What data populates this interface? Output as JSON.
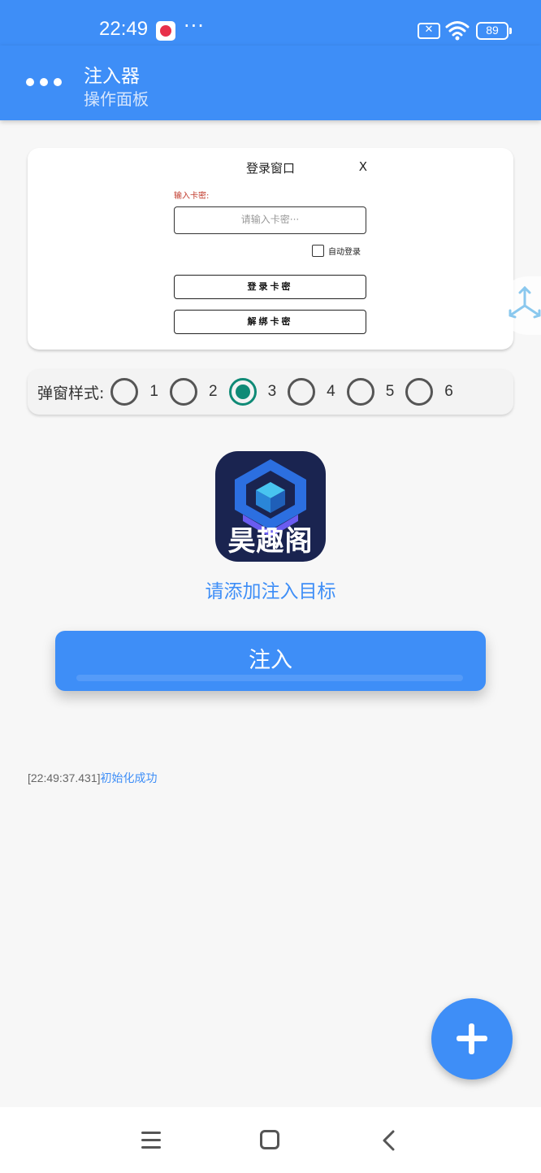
{
  "status_bar": {
    "time": "22:49",
    "more": "···",
    "battery": "89",
    "icons": [
      "app-notification-icon",
      "sim-x-icon",
      "wifi-icon",
      "battery-icon"
    ]
  },
  "app_bar": {
    "title": "注入器",
    "subtitle": "操作面板",
    "menu_icon": "more-dots-icon"
  },
  "preview": {
    "dialog_title": "登录窗口",
    "close_label": "X",
    "input_label": "输入卡密:",
    "input_placeholder": "请输入卡密···",
    "auto_login_label": "自动登录",
    "login_button": "登录卡密",
    "unbind_button": "解绑卡密",
    "label_color": "#c0392b"
  },
  "popup_style": {
    "label": "弹窗样式:",
    "options": [
      "1",
      "2",
      "3",
      "4",
      "5",
      "6"
    ],
    "selected": "3",
    "selected_color": "#0f8a76"
  },
  "target": {
    "icon_text": "昊趣阁",
    "hint": "请添加注入目标"
  },
  "inject_button": "注入",
  "log": {
    "time": "[22:49:37.431]",
    "message": "初始化成功"
  },
  "fab_icon": "plus-icon",
  "nav": [
    "recents-icon",
    "home-icon",
    "back-icon"
  ],
  "colors": {
    "primary": "#3e8ef7",
    "background": "#f7f7f7"
  }
}
